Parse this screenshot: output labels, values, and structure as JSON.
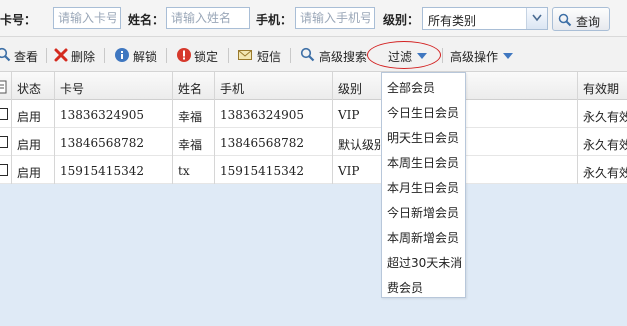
{
  "search": {
    "card_label": "卡号：",
    "card_placeholder": "请输入卡号",
    "name_label": "姓名：",
    "name_placeholder": "请输入姓名",
    "phone_label": "手机：",
    "phone_placeholder": "请输入手机号",
    "level_label": "级别：",
    "level_value": "所有类别",
    "query_label": "查询"
  },
  "toolbar": {
    "view": "查看",
    "delete": "删除",
    "unlock": "解锁",
    "lock": "锁定",
    "sms": "短信",
    "advanced_search": "高级搜索",
    "filter": "过滤",
    "advanced_ops": "高级操作"
  },
  "table": {
    "headers": [
      "状态",
      "卡号",
      "姓名",
      "手机",
      "级别",
      "有效期"
    ],
    "rows": [
      {
        "status": "启用",
        "card": "13836324905",
        "name": "幸福",
        "phone": "13836324905",
        "level": "VIP",
        "expiry": "永久有效"
      },
      {
        "status": "启用",
        "card": "13846568782",
        "name": "幸福",
        "phone": "13846568782",
        "level": "默认级别",
        "expiry": "永久有效"
      },
      {
        "status": "启用",
        "card": "15915415342",
        "name": "tx",
        "phone": "15915415342",
        "level": "VIP",
        "expiry": "永久有效"
      }
    ]
  },
  "filter_menu": {
    "items": [
      "全部会员",
      "今日生日会员",
      "明天生日会员",
      "本周生日会员",
      "本月生日会员",
      "今日新增会员",
      "本周新增会员",
      "超过30天未消",
      "费会员"
    ]
  },
  "colors": {
    "accent": "#2f6fb5",
    "highlight_ring": "#d32222",
    "background": "#dfeaf6"
  }
}
